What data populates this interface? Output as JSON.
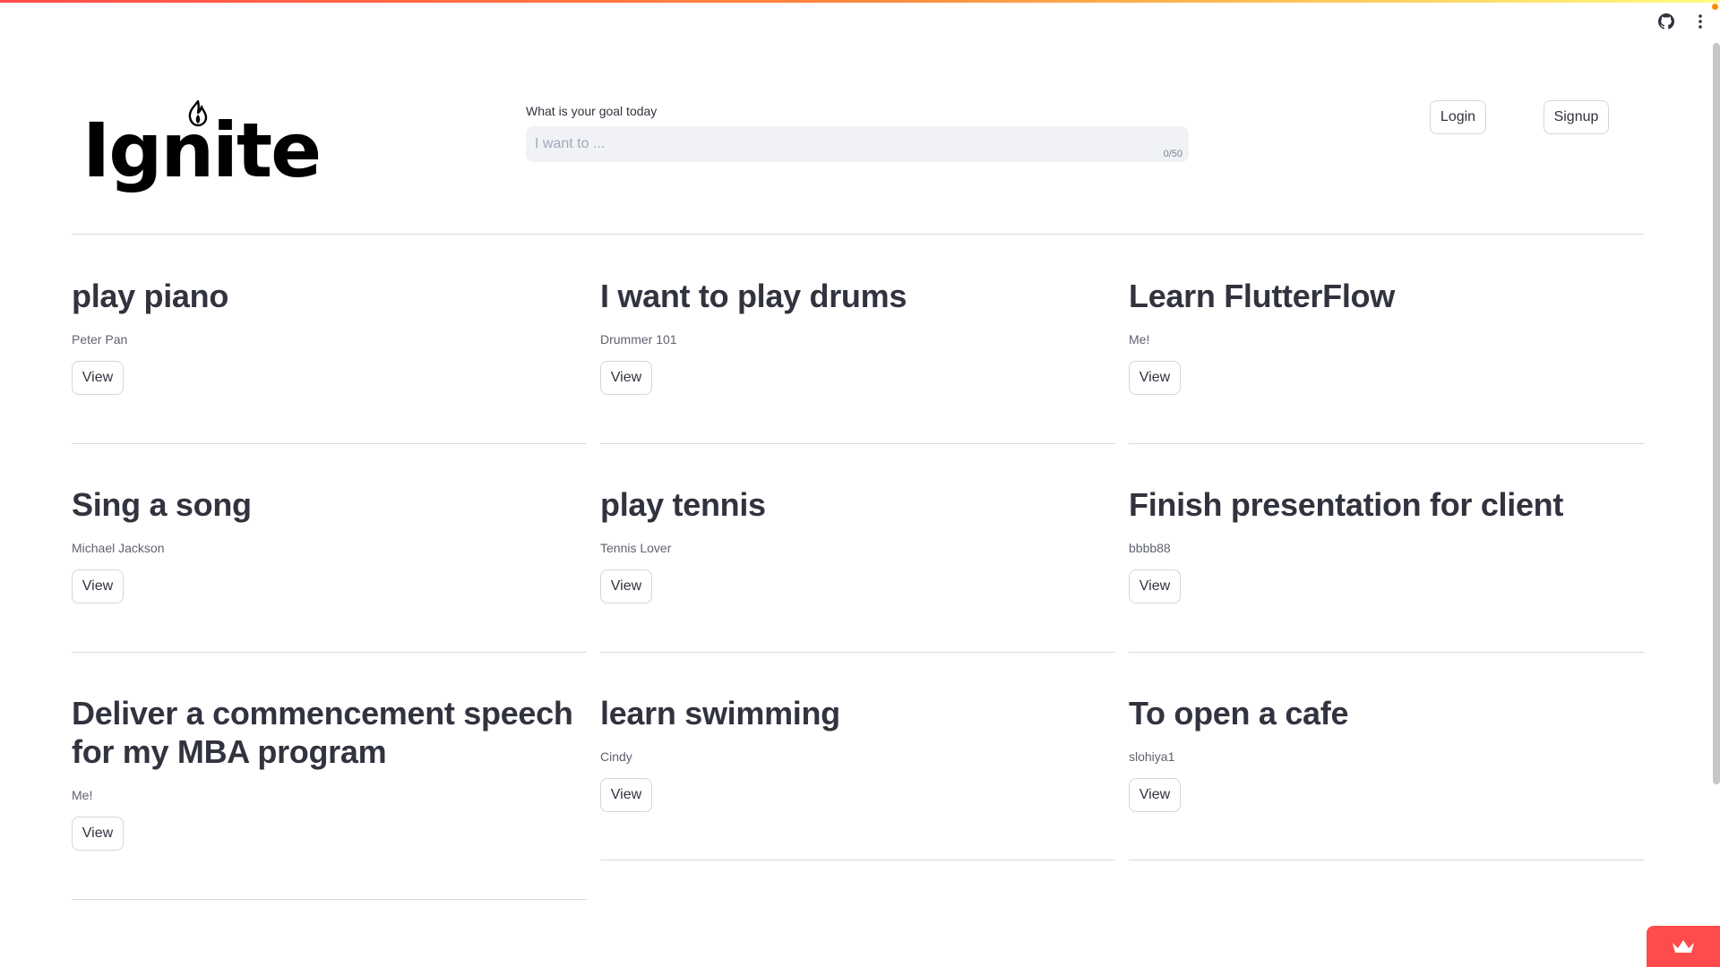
{
  "app": {
    "logo_text": "Ignite"
  },
  "goal": {
    "label": "What is your goal today",
    "placeholder": "I want to ...",
    "value": "",
    "counter": "0/50"
  },
  "auth": {
    "login_label": "Login",
    "signup_label": "Signup"
  },
  "toolbar": {
    "icons": [
      "github-icon",
      "more-vertical-icon"
    ]
  },
  "goals": [
    {
      "title": "play piano",
      "author": "Peter Pan",
      "button": "View"
    },
    {
      "title": "I want to play drums",
      "author": "Drummer 101",
      "button": "View"
    },
    {
      "title": "Learn FlutterFlow",
      "author": "Me!",
      "button": "View"
    },
    {
      "title": "Sing a song",
      "author": "Michael Jackson",
      "button": "View"
    },
    {
      "title": "play tennis",
      "author": "Tennis Lover",
      "button": "View"
    },
    {
      "title": "Finish presentation for client",
      "author": "bbbb88",
      "button": "View"
    },
    {
      "title": "Deliver a commencement speech for my MBA program",
      "author": "Me!",
      "button": "View"
    },
    {
      "title": "learn swimming",
      "author": "Cindy",
      "button": "View"
    },
    {
      "title": "To open a cafe",
      "author": "slohiya1",
      "button": "View"
    }
  ],
  "colors": {
    "accent": "#ff4b4b",
    "text": "#31333f",
    "muted": "#5f6270",
    "input_bg": "#f0f2f6",
    "divider": "#d9d9de"
  },
  "badge": {
    "icon": "crown-icon"
  }
}
